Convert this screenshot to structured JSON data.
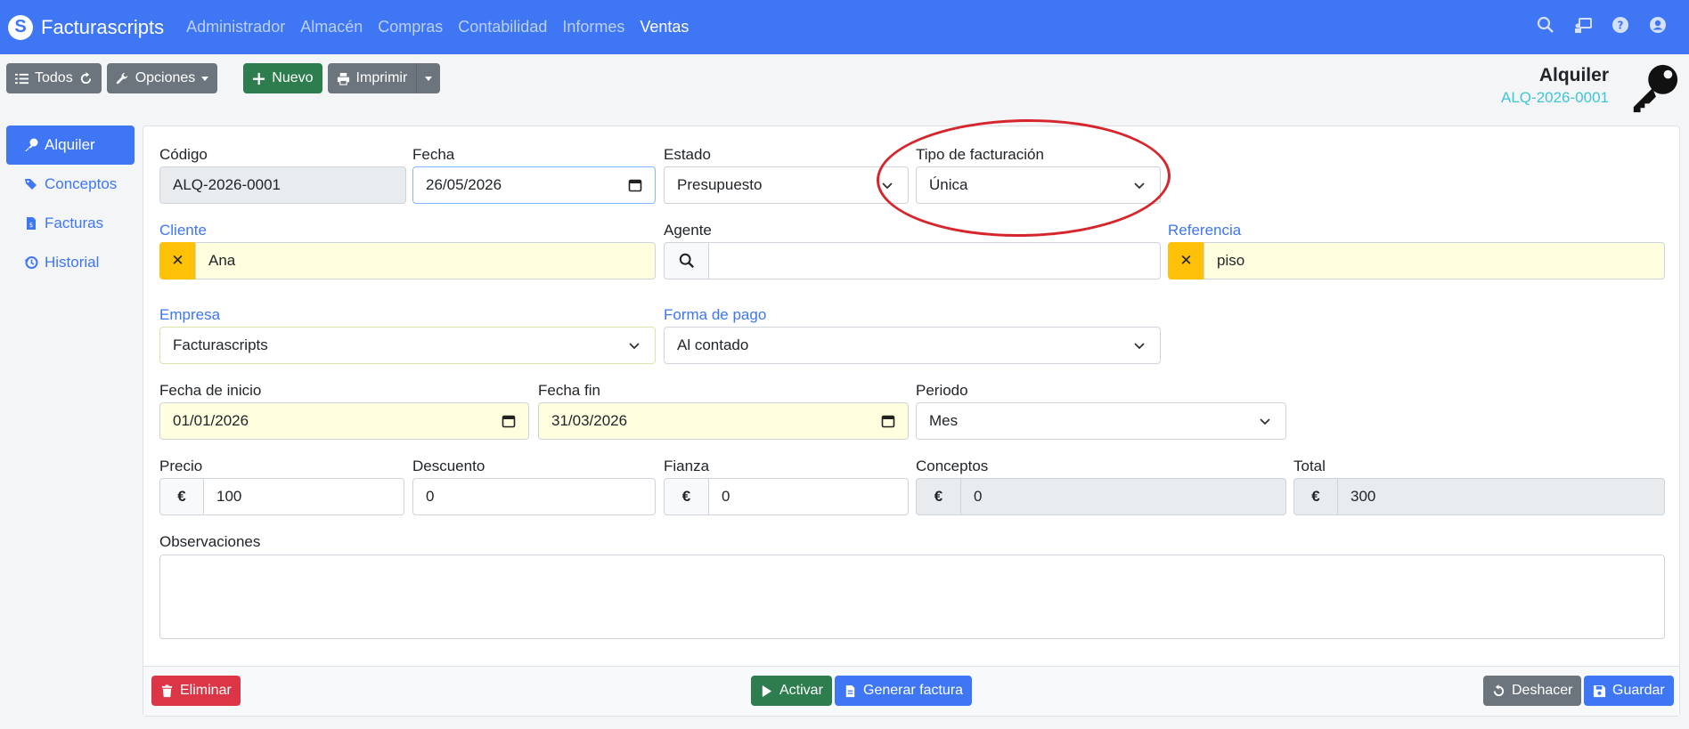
{
  "navbar": {
    "brand": "Facturascripts",
    "menu": [
      "Administrador",
      "Almacén",
      "Compras",
      "Contabilidad",
      "Informes",
      "Ventas"
    ],
    "active": "Ventas"
  },
  "toolbar": {
    "todos_label": "Todos",
    "opciones_label": "Opciones",
    "nuevo_label": "Nuevo",
    "imprimir_label": "Imprimir"
  },
  "header": {
    "title": "Alquiler",
    "code": "ALQ-2026-0001"
  },
  "sidenav": {
    "items": [
      {
        "label": "Alquiler",
        "icon": "key-icon"
      },
      {
        "label": "Conceptos",
        "icon": "tags-icon"
      },
      {
        "label": "Facturas",
        "icon": "invoice-icon"
      },
      {
        "label": "Historial",
        "icon": "history-icon"
      }
    ]
  },
  "form": {
    "codigo": {
      "label": "Código",
      "value": "ALQ-2026-0001"
    },
    "fecha": {
      "label": "Fecha",
      "value": "26/05/2026"
    },
    "estado": {
      "label": "Estado",
      "value": "Presupuesto"
    },
    "tipo_facturacion": {
      "label": "Tipo de facturación",
      "value": "Única"
    },
    "cliente": {
      "label": "Cliente",
      "value": "Ana"
    },
    "agente": {
      "label": "Agente",
      "value": ""
    },
    "referencia": {
      "label": "Referencia",
      "value": "piso"
    },
    "empresa": {
      "label": "Empresa",
      "value": "Facturascripts"
    },
    "forma_pago": {
      "label": "Forma de pago",
      "value": "Al contado"
    },
    "fecha_inicio": {
      "label": "Fecha de inicio",
      "value": "01/01/2026"
    },
    "fecha_fin": {
      "label": "Fecha fin",
      "value": "31/03/2026"
    },
    "periodo": {
      "label": "Periodo",
      "value": "Mes"
    },
    "precio": {
      "label": "Precio",
      "value": "100",
      "currency": "€"
    },
    "descuento": {
      "label": "Descuento",
      "value": "0"
    },
    "fianza": {
      "label": "Fianza",
      "value": "0",
      "currency": "€"
    },
    "conceptos": {
      "label": "Conceptos",
      "value": "0",
      "currency": "€"
    },
    "total": {
      "label": "Total",
      "value": "300",
      "currency": "€"
    },
    "observaciones": {
      "label": "Observaciones",
      "value": ""
    }
  },
  "footer": {
    "eliminar_label": "Eliminar",
    "activar_label": "Activar",
    "generar_label": "Generar factura",
    "deshacer_label": "Deshacer",
    "guardar_label": "Guardar"
  },
  "colors": {
    "primary": "#3e76f3",
    "success": "#2e7d4f",
    "danger": "#dc3545",
    "secondary": "#6c757d",
    "warning": "#ffc107",
    "highlight_ellipse": "#d6262c"
  }
}
